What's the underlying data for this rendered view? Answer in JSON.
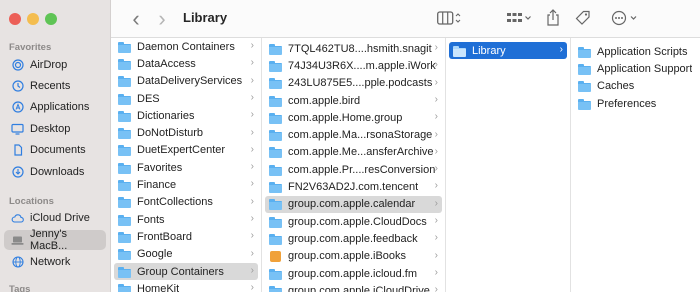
{
  "toolbar": {
    "title": "Library",
    "back": "‹",
    "forward": "›",
    "icons": [
      "columns-view-icon",
      "group-icon",
      "share-icon",
      "tag-icon",
      "more-icon"
    ]
  },
  "sidebar": {
    "favorites_header": "Favorites",
    "locations_header": "Locations",
    "tags_header": "Tags",
    "favorites": [
      {
        "label": "AirDrop",
        "icon": "airdrop-icon"
      },
      {
        "label": "Recents",
        "icon": "clock-icon"
      },
      {
        "label": "Applications",
        "icon": "applications-icon"
      },
      {
        "label": "Desktop",
        "icon": "desktop-icon"
      },
      {
        "label": "Documents",
        "icon": "document-icon"
      },
      {
        "label": "Downloads",
        "icon": "download-icon"
      }
    ],
    "locations": [
      {
        "label": "iCloud Drive",
        "icon": "cloud-icon"
      },
      {
        "label": "Jenny's MacB...",
        "icon": "laptop-icon",
        "selected": true
      },
      {
        "label": "Network",
        "icon": "network-icon"
      }
    ]
  },
  "columns": {
    "col1": [
      "Daemon Containers",
      "DataAccess",
      "DataDeliveryServices",
      "DES",
      "Dictionaries",
      "DoNotDisturb",
      "DuetExpertCenter",
      "Favorites",
      "Finance",
      "FontCollections",
      "Fonts",
      "FrontBoard",
      "Google",
      "Group Containers",
      "HomeKit"
    ],
    "col2": [
      "7TQL462TU8....hsmith.snagit",
      "74J34U3R6X....m.apple.iWork",
      "243LU875E5....pple.podcasts",
      "com.apple.bird",
      "com.apple.Home.group",
      "com.apple.Ma...rsonaStorage",
      "com.apple.Me...ansferArchive",
      "com.apple.Pr....resConversion",
      "FN2V63AD2J.com.tencent",
      "group.com.apple.calendar",
      "group.com.apple.CloudDocs",
      "group.com.apple.feedback",
      "group.com.apple.iBooks",
      "group.com.apple.icloud.fm",
      "group.com.apple.iCloudDrive"
    ],
    "col3": [
      "Library"
    ],
    "col4": [
      "Application Scripts",
      "Application Support",
      "Caches",
      "Preferences"
    ]
  }
}
